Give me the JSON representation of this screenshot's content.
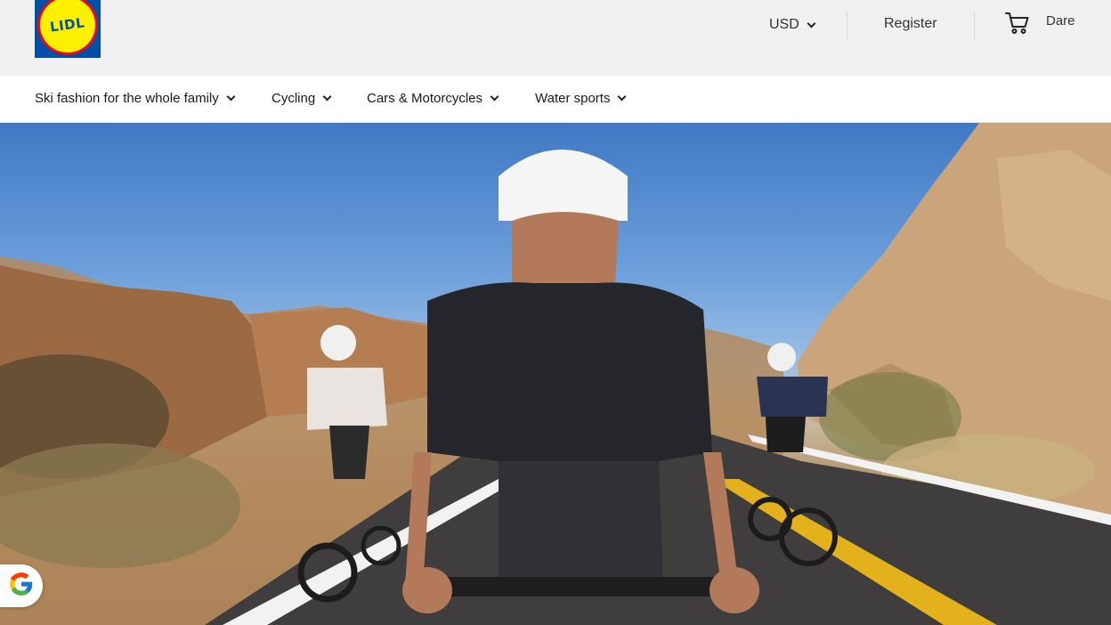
{
  "header": {
    "logo_text": "LIDL",
    "currency": "USD",
    "register": "Register",
    "user_name": "Dare"
  },
  "nav": {
    "items": [
      {
        "label": "Ski fashion for the whole family"
      },
      {
        "label": "Cycling"
      },
      {
        "label": "Cars & Motorcycles"
      },
      {
        "label": "Water sports"
      }
    ]
  },
  "hero": {
    "image": "road-cyclists-desert-photo"
  },
  "icons": {
    "cart": "shopping-cart-icon",
    "google": "google-logo-icon",
    "chevron": "chevron-down-icon"
  },
  "colors": {
    "logo_blue": "#0050aa",
    "logo_yellow": "#fff000",
    "logo_red": "#e60a14",
    "header_bg": "#f1f1f1"
  }
}
